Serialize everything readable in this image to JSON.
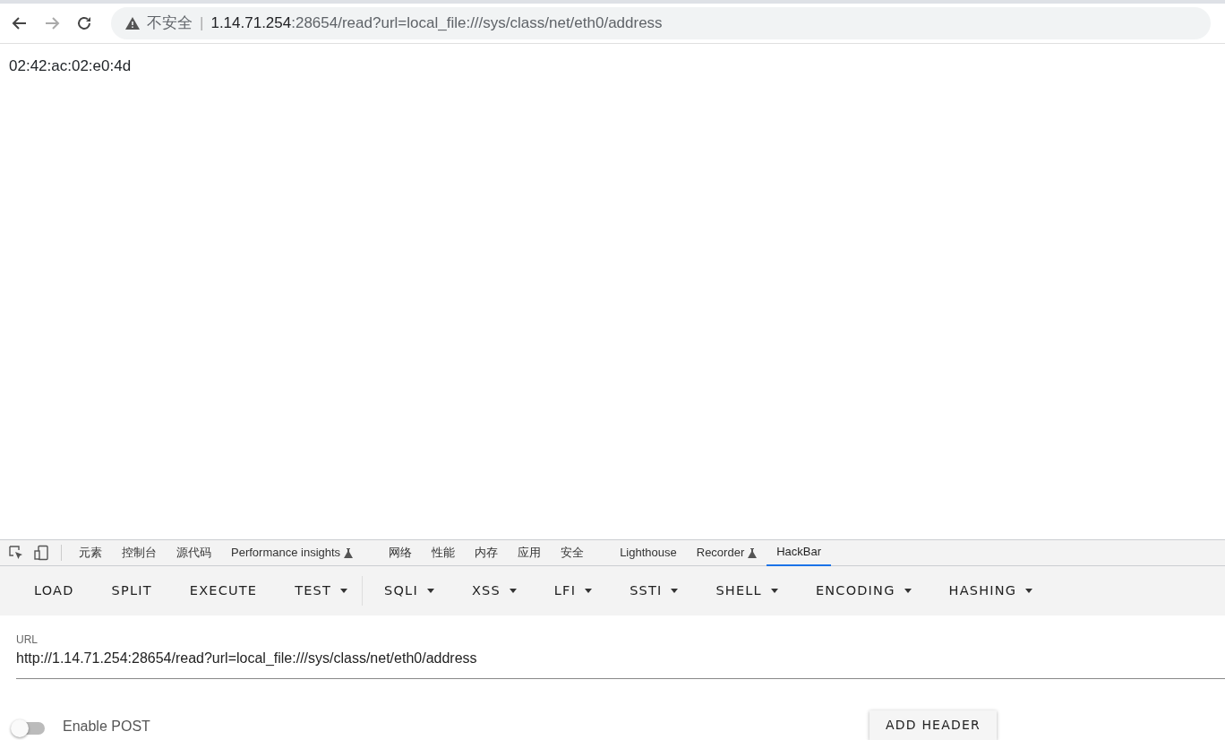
{
  "browser": {
    "security_label": "不安全",
    "separator": "|",
    "address_host": "1.14.71.254",
    "address_rest": ":28654/read?url=local_file:///sys/class/net/eth0/address"
  },
  "page": {
    "content": "02:42:ac:02:e0:4d"
  },
  "devtools": {
    "tabs": [
      {
        "label": "元素",
        "selected": false,
        "experimental": false
      },
      {
        "label": "控制台",
        "selected": false,
        "experimental": false
      },
      {
        "label": "源代码",
        "selected": false,
        "experimental": false
      },
      {
        "label": "Performance insights",
        "selected": false,
        "experimental": true
      },
      {
        "label": "网络",
        "selected": false,
        "experimental": false
      },
      {
        "label": "性能",
        "selected": false,
        "experimental": false
      },
      {
        "label": "内存",
        "selected": false,
        "experimental": false
      },
      {
        "label": "应用",
        "selected": false,
        "experimental": false
      },
      {
        "label": "安全",
        "selected": false,
        "experimental": false
      },
      {
        "label": "Lighthouse",
        "selected": false,
        "experimental": false
      },
      {
        "label": "Recorder",
        "selected": false,
        "experimental": true
      },
      {
        "label": "HackBar",
        "selected": true,
        "experimental": false
      }
    ]
  },
  "hackbar": {
    "toolbar": [
      {
        "label": "LOAD",
        "dropdown": false,
        "divider_after": false
      },
      {
        "label": "SPLIT",
        "dropdown": false,
        "divider_after": false
      },
      {
        "label": "EXECUTE",
        "dropdown": false,
        "divider_after": false
      },
      {
        "label": "TEST",
        "dropdown": true,
        "divider_after": true
      },
      {
        "label": "SQLI",
        "dropdown": true,
        "divider_after": false
      },
      {
        "label": "XSS",
        "dropdown": true,
        "divider_after": false
      },
      {
        "label": "LFI",
        "dropdown": true,
        "divider_after": false
      },
      {
        "label": "SSTI",
        "dropdown": true,
        "divider_after": false
      },
      {
        "label": "SHELL",
        "dropdown": true,
        "divider_after": false
      },
      {
        "label": "ENCODING",
        "dropdown": true,
        "divider_after": false
      },
      {
        "label": "HASHING",
        "dropdown": true,
        "divider_after": false
      }
    ],
    "url_label": "URL",
    "url_value": "http://1.14.71.254:28654/read?url=local_file:///sys/class/net/eth0/address",
    "enable_post": {
      "label": "Enable POST",
      "on": false
    },
    "add_header": "ADD HEADER"
  }
}
